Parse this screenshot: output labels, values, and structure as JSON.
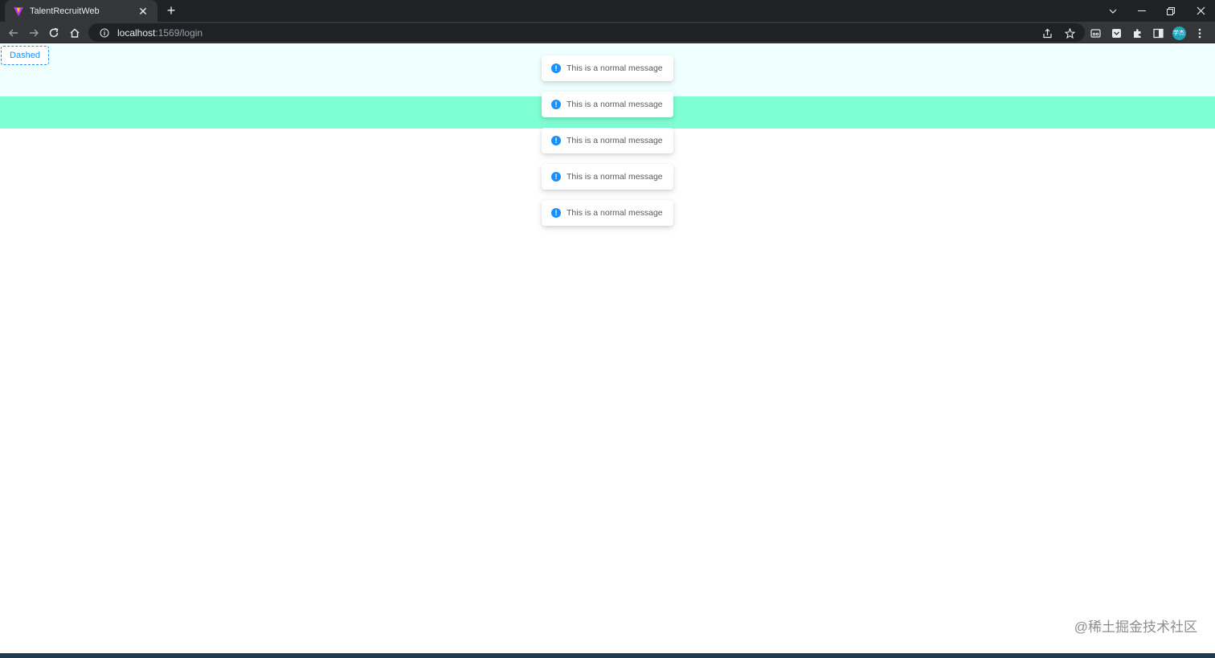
{
  "browser": {
    "tab_title": "TalentRecruitWeb",
    "tab_close": "✕",
    "new_tab": "+",
    "url_host": "localhost",
    "url_rest": ":1569/login",
    "profile_text": "学杰"
  },
  "page": {
    "dashed_button_label": "Dashed",
    "messages": [
      "This is a normal message",
      "This is a normal message",
      "This is a normal message",
      "This is a normal message",
      "This is a normal message"
    ],
    "message_icon": "!",
    "watermark": "@稀土掘金技术社区"
  },
  "colors": {
    "accent": "#1890ff",
    "band_light": "#f0ffff",
    "band_green": "#7fffd4"
  }
}
